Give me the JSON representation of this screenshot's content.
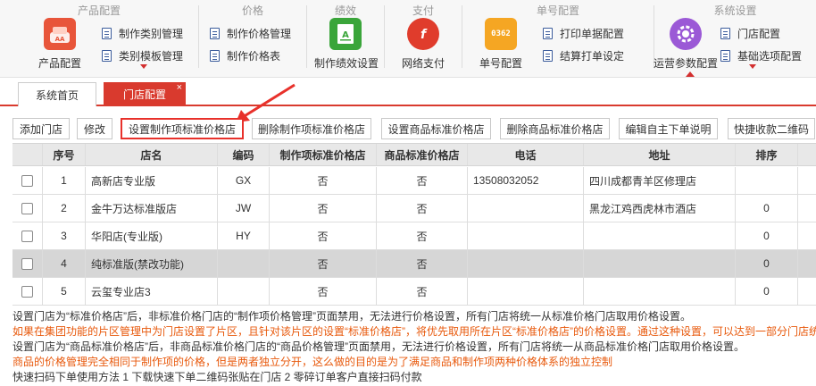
{
  "ribbon": {
    "groups": [
      {
        "title": "产品配置",
        "big_label": "产品配置",
        "items": [
          "制作类别管理",
          "类别模板管理"
        ]
      },
      {
        "title": "价格",
        "items": [
          "制作价格管理",
          "制作价格表"
        ]
      },
      {
        "title": "绩效",
        "big_label": "制作绩效设置"
      },
      {
        "title": "支付",
        "big_label": "网络支付"
      },
      {
        "title": "单号配置",
        "big_label": "单号配置",
        "badge": "0362",
        "items": [
          "打印单据配置",
          "结算打单设定"
        ]
      },
      {
        "title": "系统设置",
        "big_label": "运营参数配置",
        "items": [
          "门店配置",
          "基础选项配置"
        ]
      }
    ],
    "colors": {
      "product": "#e8553a",
      "perf": "#3aa53a",
      "pay": "#e03c2c",
      "order": "#f5a623",
      "ops": "#9b59d6"
    }
  },
  "tabs": [
    {
      "label": "系统首页"
    },
    {
      "label": "门店配置",
      "close": "×"
    }
  ],
  "toolbar": {
    "buttons": [
      "添加门店",
      "修改",
      "设置制作项标准价格店",
      "删除制作项标准价格店",
      "设置商品标准价格店",
      "删除商品标准价格店",
      "编辑自主下单说明",
      "快捷收款二维码"
    ]
  },
  "table": {
    "headers": [
      "序号",
      "店名",
      "编码",
      "制作项标准价格店",
      "商品标准价格店",
      "电话",
      "地址",
      "排序"
    ],
    "rows": [
      {
        "no": "1",
        "name": "高新店专业版",
        "code": "GX",
        "make_std": "否",
        "goods_std": "否",
        "phone": "13508032052",
        "addr": "四川成都青羊区修理店",
        "sort": "",
        "disabled": false
      },
      {
        "no": "2",
        "name": "金牛万达标准版店",
        "code": "JW",
        "make_std": "否",
        "goods_std": "否",
        "phone": "",
        "addr": "黑龙江鸡西虎林市酒店",
        "sort": "0",
        "disabled": false
      },
      {
        "no": "3",
        "name": "华阳店(专业版)",
        "code": "HY",
        "make_std": "否",
        "goods_std": "否",
        "phone": "",
        "addr": "",
        "sort": "0",
        "disabled": false
      },
      {
        "no": "4",
        "name": "纯标准版(禁改功能)",
        "code": "",
        "make_std": "否",
        "goods_std": "否",
        "phone": "",
        "addr": "",
        "sort": "0",
        "disabled": true
      },
      {
        "no": "5",
        "name": "云玺专业店3",
        "code": "",
        "make_std": "否",
        "goods_std": "否",
        "phone": "",
        "addr": "",
        "sort": "0",
        "disabled": false
      }
    ]
  },
  "notes": [
    "设置门店为“标准价格店”后，非标准价格门店的“制作项价格管理”页面禁用，无法进行价格设置，所有门店将统一从标准价格门店取用价格设置。",
    "如果在集团功能的片区管理中为门店设置了片区，且针对该片区的设置“标准价格店”，将优先取用所在片区“标准价格店”的价格设置。通过这种设置，可以达到一部分门店统一使用一套价格",
    "设置门店为“商品标准价格店”后，非商品标准价格门店的“商品价格管理”页面禁用，无法进行价格设置，所有门店将统一从商品标准价格门店取用价格设置。",
    "商品的价格管理完全相同于制作项的价格，但是两者独立分开，这么做的目的是为了满足商品和制作项两种价格体系的独立控制",
    "快速扫码下单使用方法 1 下载快速下单二维码张贴在门店 2 零碎订单客户直接扫码付款"
  ]
}
